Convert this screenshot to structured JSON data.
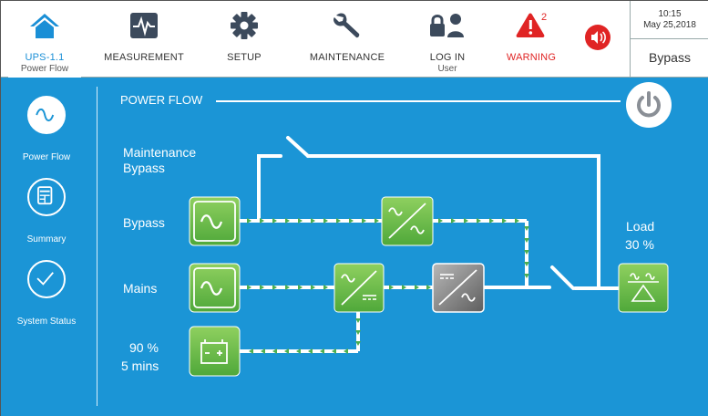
{
  "topbar": {
    "ups": {
      "label": "UPS-1.1",
      "sub": "Power Flow"
    },
    "measurement": {
      "label": "MEASUREMENT"
    },
    "setup": {
      "label": "SETUP"
    },
    "maintenance": {
      "label": "MAINTENANCE"
    },
    "login": {
      "label": "LOG IN",
      "sub": "User"
    },
    "warning": {
      "label": "WARNING",
      "count": "2"
    },
    "clock": {
      "time": "10:15",
      "date": "May 25,2018"
    },
    "mode": "Bypass"
  },
  "sidebar": {
    "items": [
      {
        "label": "Power Flow",
        "icon": "sine-wave-icon"
      },
      {
        "label": "Summary",
        "icon": "summary-document-icon"
      },
      {
        "label": "System Status",
        "icon": "checkmark-icon"
      }
    ]
  },
  "power_flow": {
    "title": "POWER FLOW",
    "maintenance_bypass": "Maintenance\nBypass",
    "bypass": "Bypass",
    "mains": "Mains",
    "battery_percent": "90 %",
    "battery_time": "5 mins",
    "load_label": "Load",
    "load_percent": "30 %"
  },
  "colors": {
    "background": "#1b95d6",
    "accent": "#1a8fd6",
    "warning": "#e02424",
    "module_green": "#6cbe45",
    "flow_arrow": "#4caf50"
  }
}
